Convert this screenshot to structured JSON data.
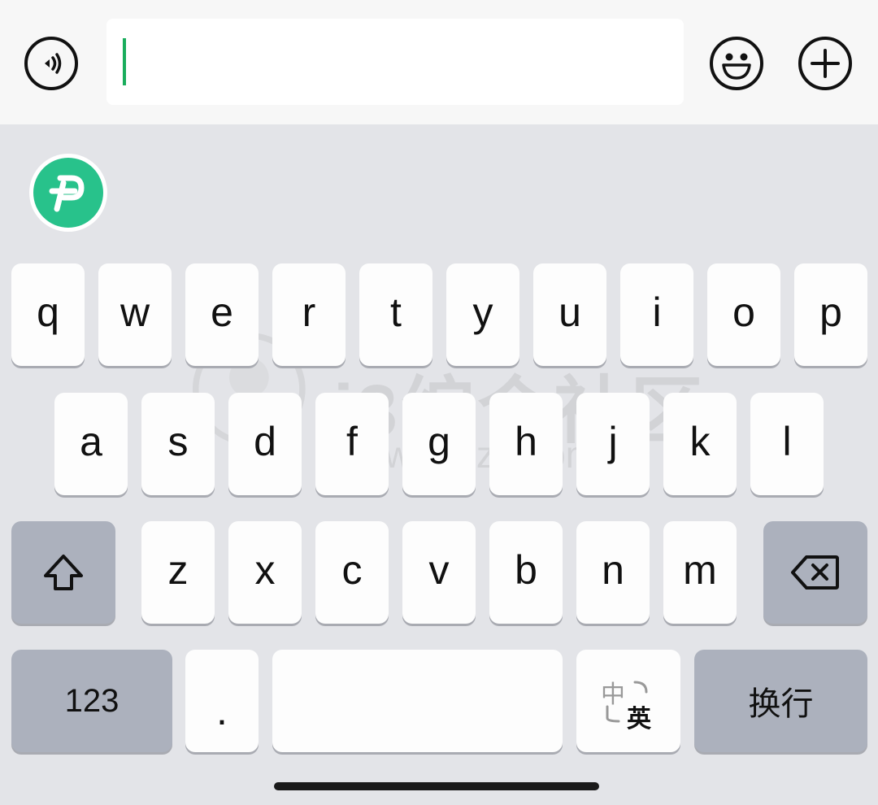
{
  "input_bar": {
    "voice_icon": "voice-icon",
    "text_value": "",
    "emoji_icon": "emoji-icon",
    "plus_icon": "plus-icon"
  },
  "suggestion_bar": {
    "app_icon": "app-logo-icon",
    "app_color": "#28c28b"
  },
  "keyboard": {
    "row1": [
      "q",
      "w",
      "e",
      "r",
      "t",
      "y",
      "u",
      "i",
      "o",
      "p"
    ],
    "row2": [
      "a",
      "s",
      "d",
      "f",
      "g",
      "h",
      "j",
      "k",
      "l"
    ],
    "row3": [
      "z",
      "x",
      "c",
      "v",
      "b",
      "n",
      "m"
    ],
    "shift_icon": "shift-icon",
    "backspace_icon": "backspace-icon",
    "numbers_label": "123",
    "period_label": ".",
    "switch_cn_label": "中",
    "switch_en_label": "英",
    "return_label": "换行"
  },
  "watermark": {
    "text": "i3综合社区",
    "url": "www.i3zh.com"
  }
}
